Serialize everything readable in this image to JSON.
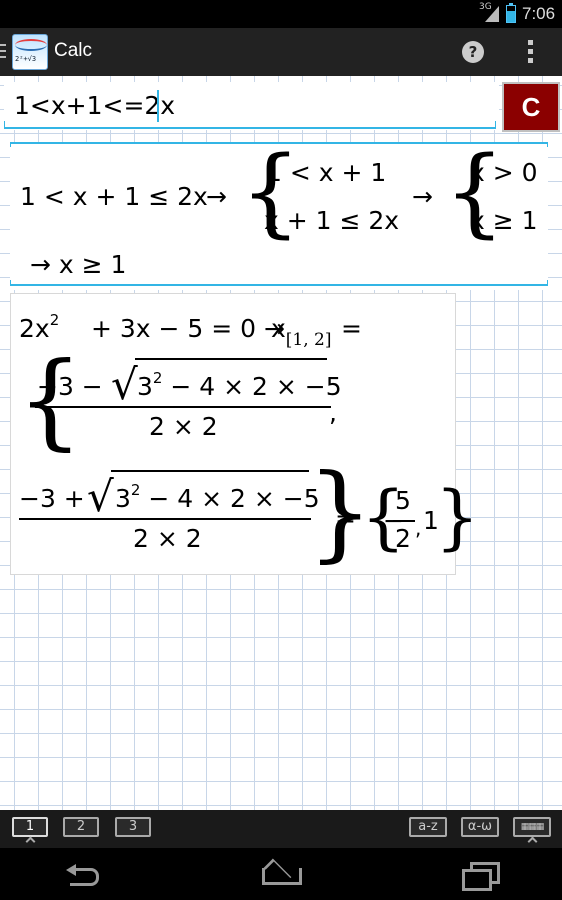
{
  "status_bar": {
    "network": "3G",
    "time": "7:06"
  },
  "action_bar": {
    "title": "Calc",
    "app_icon_formula": "2²+√3",
    "help_label": "?"
  },
  "input": {
    "value": "1<x+1<=2x"
  },
  "clear_button": {
    "label": "C"
  },
  "result1": {
    "lhs": "1 < x + 1 ≤ 2x",
    "arrow1": "→",
    "sys1_row1": "1 < x + 1",
    "sys1_row2": "x + 1 ≤ 2x",
    "arrow2": "→",
    "sys2_row1": "x > 0",
    "sys2_row2": "x ≥ 1",
    "final": "→ x ≥ 1"
  },
  "result2": {
    "eq_a": "2x",
    "eq_exp": "2",
    "eq_b": "+ 3x − 5 = 0 →",
    "eq_var": "x",
    "eq_sub": "[1, 2]",
    "eq_eq": "=",
    "root1_num_prefix": "−3 −",
    "root1_rad_base": "3",
    "root1_rad_exp": "2",
    "root1_rad_rest": "− 4 × 2 × −5",
    "root1_den": "2 × 2",
    "comma": ",",
    "root2_num_prefix": "−3 +",
    "root2_rad_base": "3",
    "root2_rad_exp": "2",
    "root2_rad_rest": "− 4 × 2 × −5",
    "root2_den": "2 × 2",
    "equals": "=",
    "ans_minus": "−",
    "ans_num": "5",
    "ans_den": "2",
    "ans_sep": ",",
    "ans_two": "1"
  },
  "keyboard_bar": {
    "k1": "1",
    "k2": "2",
    "k3": "3",
    "latin": "a-z",
    "greek": "α-ω"
  }
}
